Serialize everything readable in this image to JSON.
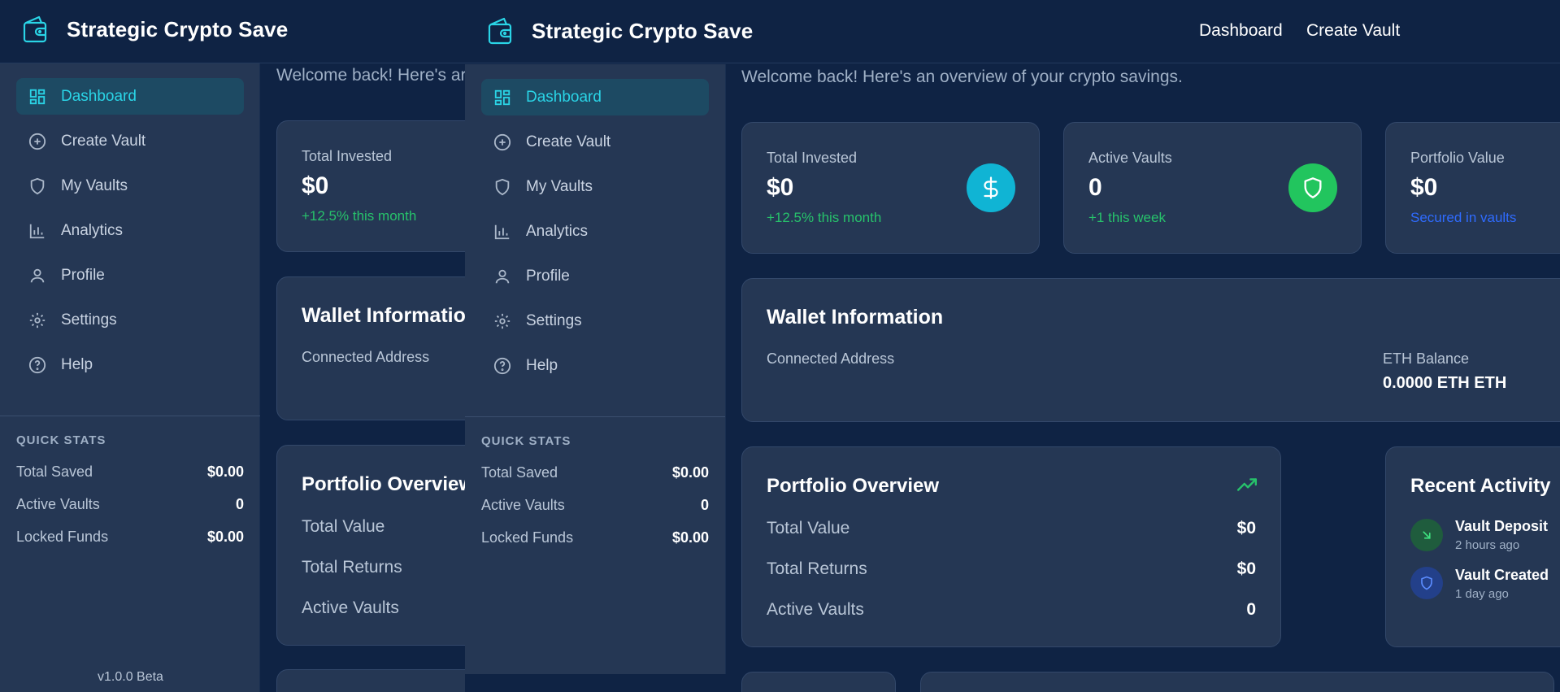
{
  "app": {
    "title": "Strategic Crypto Save"
  },
  "top_nav": {
    "dashboard": "Dashboard",
    "create_vault": "Create Vault"
  },
  "sidebar": {
    "items": [
      {
        "label": "Dashboard",
        "icon": "dashboard-icon",
        "active": true
      },
      {
        "label": "Create Vault",
        "icon": "plus-circle-icon"
      },
      {
        "label": "My Vaults",
        "icon": "shield-icon"
      },
      {
        "label": "Analytics",
        "icon": "bar-chart-icon"
      },
      {
        "label": "Profile",
        "icon": "user-icon"
      },
      {
        "label": "Settings",
        "icon": "gear-icon"
      },
      {
        "label": "Help",
        "icon": "help-circle-icon"
      }
    ],
    "quick_stats": {
      "title": "QUICK STATS",
      "rows": [
        {
          "label": "Total Saved",
          "value": "$0.00"
        },
        {
          "label": "Active Vaults",
          "value": "0"
        },
        {
          "label": "Locked Funds",
          "value": "$0.00"
        }
      ]
    },
    "version": "v1.0.0 Beta"
  },
  "main": {
    "welcome": "Welcome back! Here's an overview of your crypto savings.",
    "welcome_clipped": "Welcome back! Here's ar",
    "stats": [
      {
        "label": "Total Invested",
        "value": "$0",
        "note": "+12.5% this month",
        "icon": "dollar-icon",
        "color": "#10b4d4"
      },
      {
        "label": "Active Vaults",
        "value": "0",
        "note": "+1 this week",
        "icon": "shield-icon",
        "color": "#22c55e"
      },
      {
        "label": "Portfolio Value",
        "value": "$0",
        "note": "Secured in vaults"
      }
    ],
    "wallet": {
      "title": "Wallet Information",
      "title_clipped": "Wallet Informatio",
      "address_label": "Connected Address",
      "balance_label": "ETH Balance",
      "balance_value": "0.0000 ETH ETH"
    },
    "portfolio": {
      "title": "Portfolio Overview",
      "rows": [
        {
          "label": "Total Value",
          "value": "$0"
        },
        {
          "label": "Total Returns",
          "value": "$0"
        },
        {
          "label": "Active Vaults",
          "value": "0"
        }
      ]
    },
    "activity": {
      "title": "Recent Activity",
      "items": [
        {
          "title": "Vault Deposit",
          "time": "2 hours ago",
          "icon": "arrow-down-right-icon"
        },
        {
          "title": "Vault Created",
          "time": "1 day ago",
          "icon": "shield-icon"
        }
      ]
    }
  },
  "colors": {
    "bg": "#0f2344",
    "panel": "#253754",
    "accent": "#2ad4e6",
    "green": "#27c26b",
    "blue": "#2f6bff"
  }
}
